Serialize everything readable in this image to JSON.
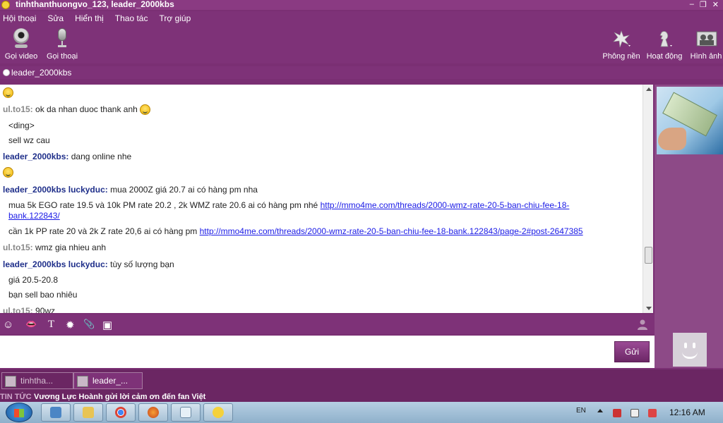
{
  "window": {
    "title": "tinhthanthuongvo_123, leader_2000kbs",
    "controls": [
      "–",
      "❐",
      "✕"
    ]
  },
  "menu": [
    "Hội thoại",
    "Sửa",
    "Hiển thị",
    "Thao tác",
    "Trợ giúp"
  ],
  "toolbar": {
    "left": [
      {
        "label": "Gọi video",
        "icon": "webcam-icon"
      },
      {
        "label": "Gọi thoại",
        "icon": "microphone-icon"
      }
    ],
    "right": [
      {
        "label": "Phông nền",
        "icon": "flower-background-icon"
      },
      {
        "label": "Hoạt động",
        "icon": "chess-knight-icon"
      },
      {
        "label": "Hình ảnh",
        "icon": "photos-icon"
      }
    ]
  },
  "contact": {
    "name": "leader_2000kbs",
    "status_icon": "offline-dot-icon"
  },
  "chat": {
    "lines": [
      {
        "sender": "",
        "text": "",
        "emoji": true,
        "indent": false
      },
      {
        "sender": "ul.to15:",
        "text": "ok da nhan duoc thank anh",
        "emoji": true,
        "indent": false
      },
      {
        "sender": "",
        "text": "<ding>",
        "indent": true
      },
      {
        "sender": "",
        "text": "sell wz cau",
        "indent": true
      },
      {
        "sender": "leader_2000kbs:",
        "text": "dang online nhe",
        "indent": false
      },
      {
        "sender": "",
        "text": "",
        "emoji": true,
        "indent": false
      },
      {
        "sender": "leader_2000kbs luckyduc:",
        "text": "mua 2000Z giá 20.7 ai có hàng pm nha",
        "indent": false
      },
      {
        "sender": "",
        "text": "mua 5k EGO rate 19.5 và 10k PM rate 20.2 , 2k WMZ rate 20.6 ai có hàng pm nhé",
        "link": "http://mmo4me.com/threads/2000-wmz-rate-20-5-ban-chiu-fee-18-",
        "indent": true
      },
      {
        "sender": "",
        "text": "",
        "link": "bank.122843/",
        "indent": true
      },
      {
        "sender": "",
        "text": "cần 1k PP rate 20 và 2k Z rate 20,6 ai có hàng pm",
        "link": "http://mmo4me.com/threads/2000-wmz-rate-20-5-ban-chiu-fee-18-bank.122843/page-2#post-2647385",
        "indent": true
      },
      {
        "sender": "ul.to15:",
        "text": "wmz gia nhieu anh",
        "indent": false
      },
      {
        "sender": "leader_2000kbs luckyduc:",
        "text": "tùy số lượng bạn",
        "indent": false
      },
      {
        "sender": "",
        "text": "giá 20.5-20.8",
        "indent": true
      },
      {
        "sender": "",
        "text": "bạn sell bao nhiêu",
        "indent": true
      },
      {
        "sender": "ul.to15:",
        "text": "90wz",
        "indent": false
      }
    ]
  },
  "format_toolbar": [
    {
      "icon": "smiley-icon",
      "glyph": "☺"
    },
    {
      "icon": "chat-bubble-icon",
      "glyph": "👄"
    },
    {
      "icon": "text-format-icon",
      "glyph": "T"
    },
    {
      "icon": "buzz-icon",
      "glyph": "✹"
    },
    {
      "icon": "attachment-icon",
      "glyph": "📎"
    },
    {
      "icon": "image-insert-icon",
      "glyph": "▣"
    }
  ],
  "input": {
    "value": "",
    "send_label": "Gửi"
  },
  "tabs": [
    {
      "label": "tinhtha...",
      "active": false
    },
    {
      "label": "leader_...",
      "active": true
    }
  ],
  "news": {
    "tag": "TIN TỨC",
    "text": "Vương Lực Hoành gửi lời cảm ơn đến fan Việt"
  },
  "taskbar": {
    "apps": [
      "network-icon",
      "folder-icon",
      "chrome-icon",
      "firefox-icon",
      "notepad-icon",
      "yahoo-messenger-icon"
    ],
    "language": "EN",
    "clock": "12:16 AM"
  },
  "colors": {
    "chrome": "#7e3278",
    "sender_blue": "#1f2f8a",
    "sender_gray": "#888888",
    "link": "#1a1ae6"
  }
}
